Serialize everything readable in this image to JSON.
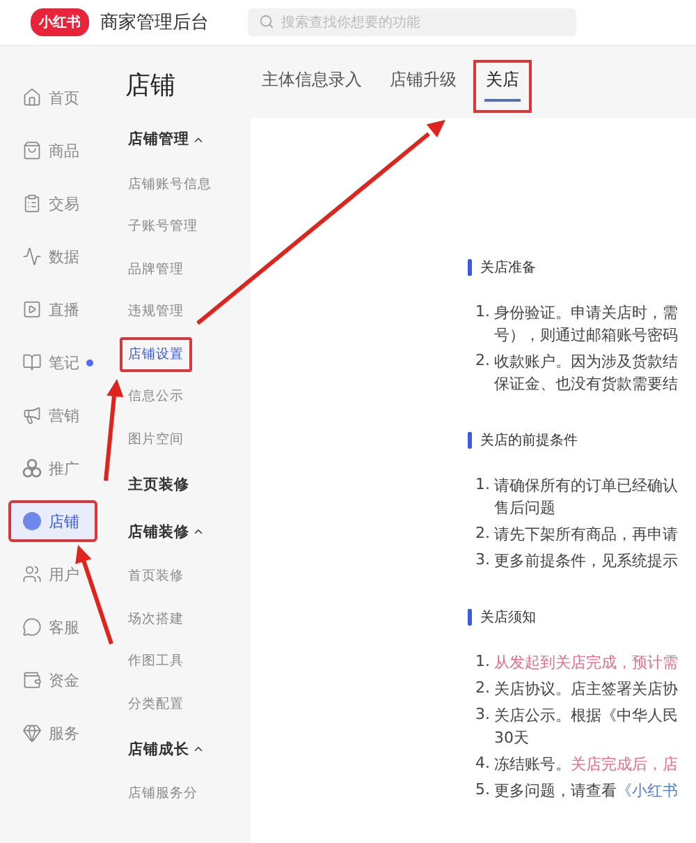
{
  "header": {
    "logo": "小红书",
    "title": "商家管理后台",
    "search": {
      "placeholder": "搜索查找你想要的功能"
    }
  },
  "sidebar": {
    "items": [
      {
        "label": "首页",
        "selected": false,
        "annotated": false,
        "dot": false
      },
      {
        "label": "商品",
        "selected": false,
        "annotated": false,
        "dot": false
      },
      {
        "label": "交易",
        "selected": false,
        "annotated": false,
        "dot": false
      },
      {
        "label": "数据",
        "selected": false,
        "annotated": false,
        "dot": false
      },
      {
        "label": "直播",
        "selected": false,
        "annotated": false,
        "dot": false
      },
      {
        "label": "笔记",
        "selected": false,
        "annotated": false,
        "dot": true
      },
      {
        "label": "营销",
        "selected": false,
        "annotated": false,
        "dot": false
      },
      {
        "label": "推广",
        "selected": false,
        "annotated": false,
        "dot": false
      },
      {
        "label": "店铺",
        "selected": true,
        "annotated": true,
        "dot": false
      },
      {
        "label": "用户",
        "selected": false,
        "annotated": false,
        "dot": false
      },
      {
        "label": "客服",
        "selected": false,
        "annotated": false,
        "dot": false
      },
      {
        "label": "资金",
        "selected": false,
        "annotated": false,
        "dot": false
      },
      {
        "label": "服务",
        "selected": false,
        "annotated": false,
        "dot": false
      }
    ]
  },
  "subnav": {
    "title": "店铺",
    "entries": [
      {
        "kind": "group",
        "label": "店铺管理",
        "expanded": true
      },
      {
        "kind": "item",
        "label": "店铺账号信息",
        "selected": false,
        "annotated": false
      },
      {
        "kind": "item",
        "label": "子账号管理",
        "selected": false,
        "annotated": false
      },
      {
        "kind": "item",
        "label": "品牌管理",
        "selected": false,
        "annotated": false
      },
      {
        "kind": "item",
        "label": "违规管理",
        "selected": false,
        "annotated": false
      },
      {
        "kind": "item",
        "label": "店铺设置",
        "selected": true,
        "annotated": true
      },
      {
        "kind": "item",
        "label": "信息公示",
        "selected": false,
        "annotated": false
      },
      {
        "kind": "item",
        "label": "图片空间",
        "selected": false,
        "annotated": false
      },
      {
        "kind": "page",
        "label": "主页装修"
      },
      {
        "kind": "group",
        "label": "店铺装修",
        "expanded": true
      },
      {
        "kind": "item",
        "label": "首页装修",
        "selected": false,
        "annotated": false
      },
      {
        "kind": "item",
        "label": "场次搭建",
        "selected": false,
        "annotated": false
      },
      {
        "kind": "item",
        "label": "作图工具",
        "selected": false,
        "annotated": false
      },
      {
        "kind": "item",
        "label": "分类配置",
        "selected": false,
        "annotated": false
      },
      {
        "kind": "group",
        "label": "店铺成长",
        "expanded": true
      },
      {
        "kind": "item",
        "label": "店铺服务分",
        "selected": false,
        "annotated": false
      }
    ]
  },
  "tabs": [
    {
      "label": "主体信息录入",
      "selected": false,
      "annotated": false
    },
    {
      "label": "店铺升级",
      "selected": false,
      "annotated": false
    },
    {
      "label": "关店",
      "selected": true,
      "annotated": true
    }
  ],
  "sections": [
    {
      "heading": "关店准备",
      "items": [
        {
          "number": "1.",
          "lines": [
            [
              {
                "text": "身份验证。申请关店时，需",
                "kind": "normal"
              }
            ],
            [
              {
                "text": "号），则通过邮箱账号密码",
                "kind": "normal"
              }
            ]
          ]
        },
        {
          "number": "2.",
          "lines": [
            [
              {
                "text": "收款账户。因为涉及货款结",
                "kind": "normal"
              }
            ],
            [
              {
                "text": "保证金、也没有货款需要结",
                "kind": "normal"
              }
            ]
          ]
        }
      ]
    },
    {
      "heading": "关店的前提条件",
      "items": [
        {
          "number": "1.",
          "lines": [
            [
              {
                "text": "请确保所有的订单已经确认",
                "kind": "normal"
              }
            ],
            [
              {
                "text": "售后问题",
                "kind": "normal"
              }
            ]
          ]
        },
        {
          "number": "2.",
          "lines": [
            [
              {
                "text": "请先下架所有商品，再申请",
                "kind": "normal"
              }
            ]
          ]
        },
        {
          "number": "3.",
          "lines": [
            [
              {
                "text": "更多前提条件，见系统提示",
                "kind": "normal"
              }
            ]
          ]
        }
      ]
    },
    {
      "heading": "关店须知",
      "items": [
        {
          "number": "1.",
          "lines": [
            [
              {
                "text": "从发起到关店完成，预计需",
                "kind": "warning"
              }
            ]
          ]
        },
        {
          "number": "2.",
          "lines": [
            [
              {
                "text": "关店协议。店主签署关店协",
                "kind": "normal"
              }
            ]
          ]
        },
        {
          "number": "3.",
          "lines": [
            [
              {
                "text": "关店公示。根据《中华人民",
                "kind": "normal"
              }
            ],
            [
              {
                "text": "30天",
                "kind": "normal"
              }
            ]
          ]
        },
        {
          "number": "4.",
          "lines": [
            [
              {
                "text": "冻结账号。",
                "kind": "normal"
              },
              {
                "text": "关店完成后，店",
                "kind": "warning"
              }
            ]
          ]
        },
        {
          "number": "5.",
          "lines": [
            [
              {
                "text": "更多问题，请查看",
                "kind": "normal"
              },
              {
                "text": "《小红书",
                "kind": "link"
              }
            ]
          ]
        }
      ]
    }
  ]
}
